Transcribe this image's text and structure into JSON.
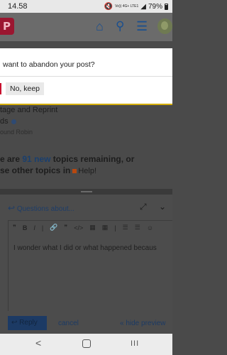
{
  "status": {
    "time": "14.58",
    "network": "Vo)) 4G+ LTE1",
    "battery": "79%"
  },
  "header": {
    "logo_letter": "P",
    "icons": [
      "home-icon",
      "search-icon",
      "hamburger-menu-icon",
      "user-avatar"
    ]
  },
  "modal": {
    "question": "want to abandon your post?",
    "keep_button": "No, keep"
  },
  "topic": {
    "title_line1": "tage and Reprint",
    "title_line2": "ds",
    "author": "ound Robin"
  },
  "suggested": {
    "line1_prefix": "e are ",
    "count": "91",
    "new_word": "new",
    "line1_suffix": " topics remaining, or",
    "line2_prefix": "se other topics in",
    "category": "Help!"
  },
  "composer": {
    "reply_to": "Questions about...",
    "editor_text": "I wonder what I did or what happened becaus",
    "reply_button": "Reply",
    "cancel": "cancel",
    "hide_preview": "« hide preview"
  },
  "navbar": {
    "back": "<",
    "recents": "III"
  },
  "colors": {
    "accent_red": "#c8102e",
    "link_blue": "#1a3f6e",
    "warning_yellow": "#d4ad00",
    "logo_red": "#9b1630"
  }
}
